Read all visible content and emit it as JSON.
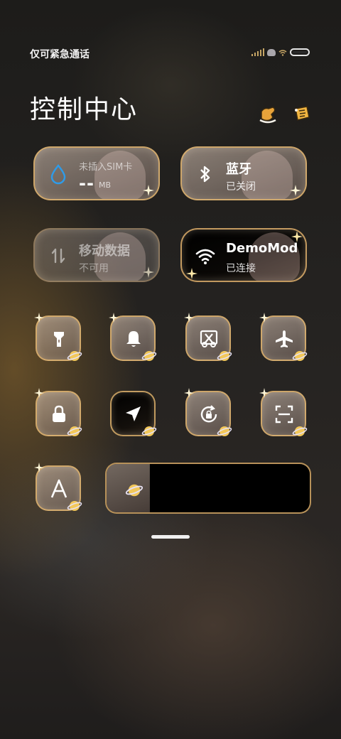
{
  "status_bar": {
    "carrier_text": "仅可紧急通话"
  },
  "header": {
    "title": "控制中心"
  },
  "tiles": {
    "data_usage": {
      "title": "未插入SIM卡",
      "value": "--",
      "unit": "MB"
    },
    "bluetooth": {
      "title": "蓝牙",
      "status": "已关闭"
    },
    "mobile_data": {
      "title": "移动数据",
      "status": "不可用"
    },
    "wifi": {
      "title": "DemoMod",
      "status": "已连接"
    }
  },
  "quick_toggles": [
    {
      "name": "flashlight",
      "icon": "flashlight-icon",
      "active": false
    },
    {
      "name": "notification",
      "icon": "bell-icon",
      "active": false
    },
    {
      "name": "screenshot",
      "icon": "scissors-icon",
      "active": false
    },
    {
      "name": "airplane",
      "icon": "airplane-icon",
      "active": false
    },
    {
      "name": "lock",
      "icon": "lock-icon",
      "active": false
    },
    {
      "name": "location",
      "icon": "location-arrow-icon",
      "active": true
    },
    {
      "name": "rotation",
      "icon": "rotation-lock-icon",
      "active": false
    },
    {
      "name": "scan",
      "icon": "scan-icon",
      "active": false
    },
    {
      "name": "reading-mode",
      "icon": "font-a-icon",
      "active": false
    }
  ],
  "brightness": {
    "level": 0.21
  },
  "colors": {
    "accent_gold": "#d9b06a",
    "water_blue": "#2f9be8"
  }
}
